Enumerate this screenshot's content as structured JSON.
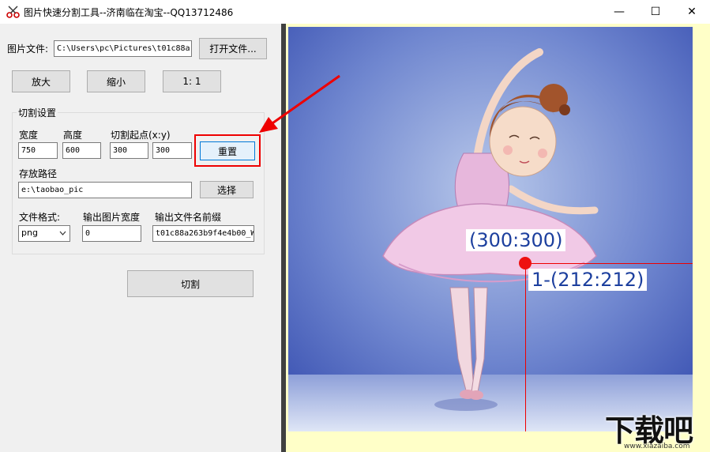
{
  "window": {
    "title": "图片快速分割工具--济南临在淘宝--QQ13712486",
    "minimize": "—",
    "maximize": "☐",
    "close": "✕"
  },
  "file": {
    "label": "图片文件:",
    "path": "C:\\Users\\pc\\Pictures\\t01c88a",
    "open_button": "打开文件..."
  },
  "zoom": {
    "zoom_in": "放大",
    "zoom_out": "缩小",
    "actual": "1: 1"
  },
  "cut_settings": {
    "group_title": "切割设置",
    "width_label": "宽度",
    "width_value": "750",
    "height_label": "高度",
    "height_value": "600",
    "start_label": "切割起点(x:y)",
    "start_x": "300",
    "start_y": "300",
    "reset_button": "重置",
    "save_path_label": "存放路径",
    "save_path_value": "e:\\taobao_pic",
    "choose_button": "选择",
    "format_label": "文件格式:",
    "format_value": "png",
    "output_width_label": "输出图片宽度",
    "output_width_value": "0",
    "prefix_label": "输出文件名前缀",
    "prefix_value": "t01c88a263b9f4e4b00_W"
  },
  "cut_button": "切割",
  "preview": {
    "start_coord": "(300:300)",
    "tile_label": "1-(212:212)"
  },
  "watermark": {
    "text": "下载吧",
    "url": "www.xiazaiba.com"
  },
  "colors": {
    "highlight": "#e00000",
    "coord_text": "#1c3f9e",
    "canvas_bg": "#ffffc8"
  }
}
